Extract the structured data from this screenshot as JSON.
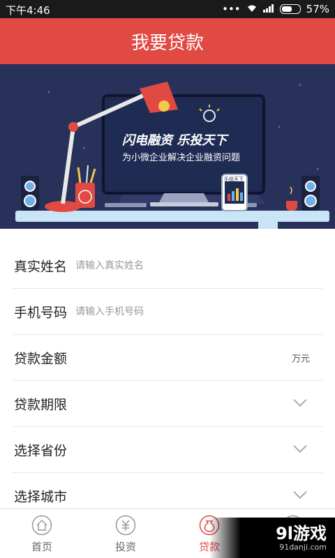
{
  "status": {
    "time": "下午4:46",
    "battery": "57%"
  },
  "header": {
    "title": "我要贷款"
  },
  "banner": {
    "headline": "闪电融资 乐投天下",
    "subtitle": "为小微企业解决企业融资问题",
    "phone_text": "乐投天下",
    "cup_text": "乐"
  },
  "form": {
    "fields": [
      {
        "label": "真实姓名",
        "placeholder": "请输入真实姓名"
      },
      {
        "label": "手机号码",
        "placeholder": "请输入手机号码"
      },
      {
        "label": "贷款金额",
        "unit": "万元"
      },
      {
        "label": "贷款期限"
      },
      {
        "label": "选择省份"
      },
      {
        "label": "选择城市"
      }
    ]
  },
  "tabbar": {
    "tabs": [
      {
        "label": "首页"
      },
      {
        "label": "投资"
      },
      {
        "label": "贷款"
      },
      {
        "label": ""
      }
    ],
    "active_color": "#e04a43"
  },
  "watermark": {
    "main": "9l游戏",
    "sub": "91danji.com"
  }
}
